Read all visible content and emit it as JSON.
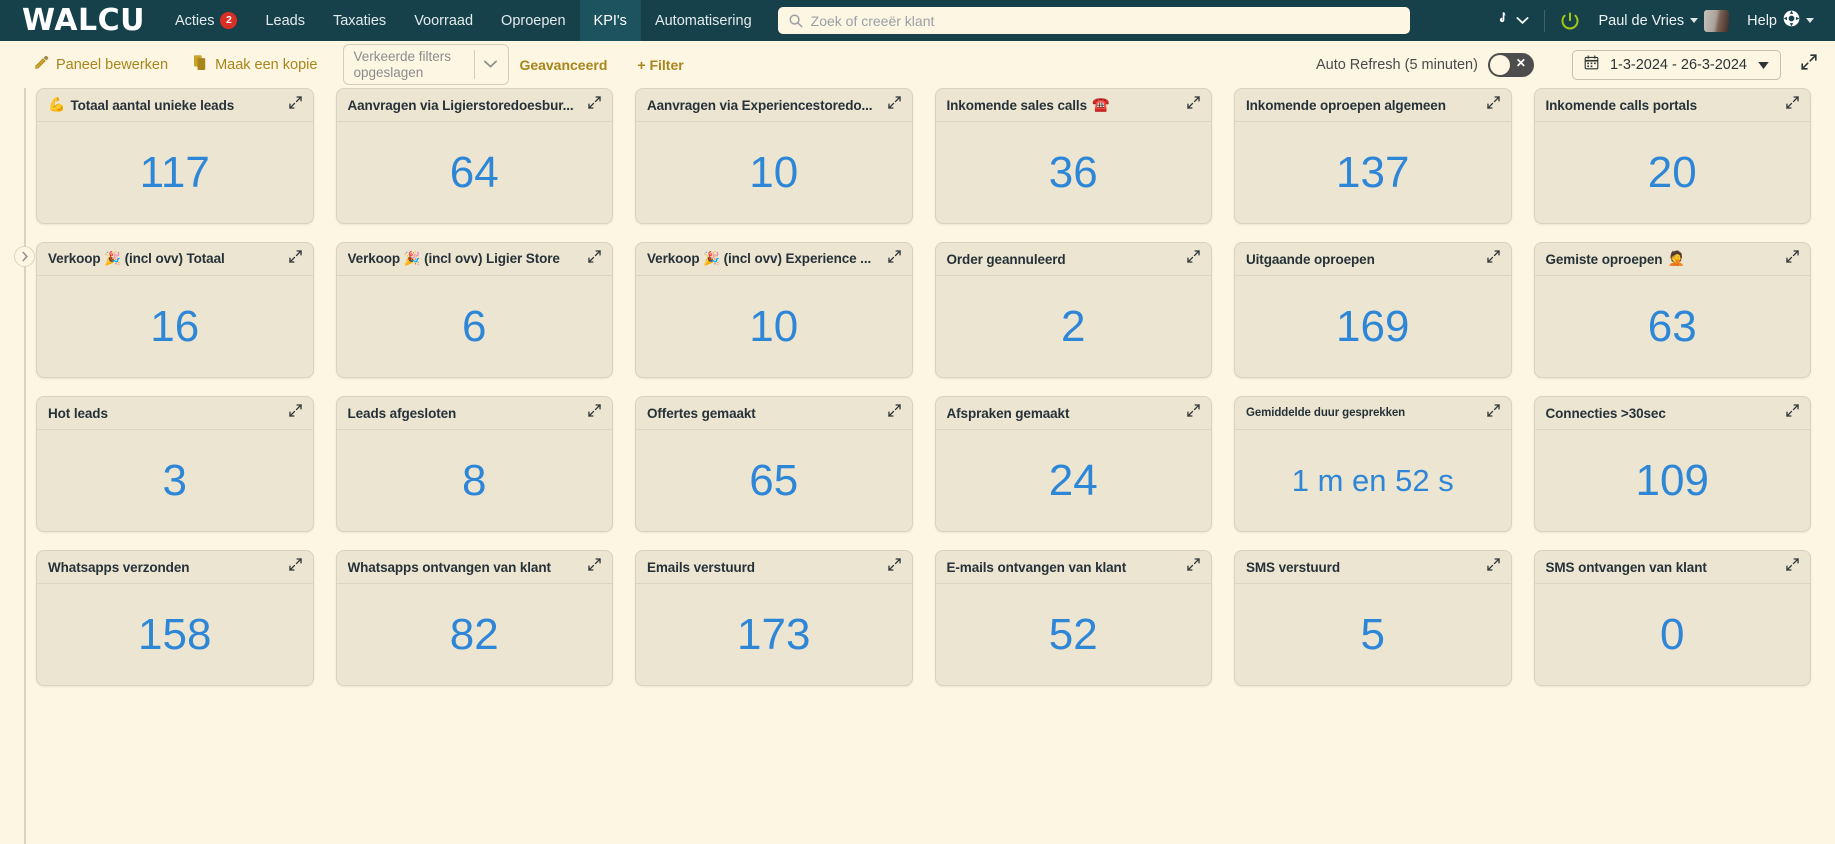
{
  "header": {
    "logo": "WALCU",
    "nav": [
      {
        "label": "Acties",
        "badge": "2",
        "active": false
      },
      {
        "label": "Leads",
        "badge": "",
        "active": false
      },
      {
        "label": "Taxaties",
        "badge": "",
        "active": false
      },
      {
        "label": "Voorraad",
        "badge": "",
        "active": false
      },
      {
        "label": "Oproepen",
        "badge": "",
        "active": false
      },
      {
        "label": "KPI's",
        "badge": "",
        "active": true
      },
      {
        "label": "Automatisering",
        "badge": "",
        "active": false
      }
    ],
    "search": {
      "placeholder": "Zoek of creeër klant",
      "value": ""
    },
    "phone_icon": "phone-icon",
    "power_icon": "power-icon",
    "user_name": "Paul de Vries",
    "help_label": "Help"
  },
  "toolbar": {
    "edit_panel_label": "Paneel bewerken",
    "copy_label": "Maak een kopie",
    "filter_select_value": "Verkeerde filters opgeslagen",
    "advanced_label": "Geavanceerd",
    "add_filter_label": "+ Filter",
    "auto_refresh_label": "Auto Refresh (5 minuten)",
    "auto_refresh_state": "off",
    "date_range": "1-3-2024 - 26-3-2024",
    "calendar_icon": "calendar-icon",
    "expand_icon": "expand-icon"
  },
  "accent_colors": {
    "nav_bg": "#16414b",
    "nav_active_bg": "#1d535f",
    "page_bg": "#fdf6e3",
    "card_bg": "#ece5d2",
    "value_blue": "#2e86d6",
    "link_gold": "#a8851a",
    "badge_red": "#d93025",
    "power_green": "#a5c614"
  },
  "cards": [
    {
      "title": "Totaal aantal unieke leads",
      "emoji": "💪",
      "emoji_pos": "before",
      "value": "117",
      "small_title": false
    },
    {
      "title": "Aanvragen via Ligierstoredoesbur...",
      "emoji": "",
      "emoji_pos": "",
      "value": "64",
      "small_title": false
    },
    {
      "title": "Aanvragen via Experiencestoredo...",
      "emoji": "",
      "emoji_pos": "",
      "value": "10",
      "small_title": false
    },
    {
      "title": "Inkomende sales calls",
      "emoji": "☎️",
      "emoji_pos": "after",
      "value": "36",
      "small_title": false
    },
    {
      "title": "Inkomende oproepen algemeen",
      "emoji": "",
      "emoji_pos": "",
      "value": "137",
      "small_title": false
    },
    {
      "title": "Inkomende calls portals",
      "emoji": "",
      "emoji_pos": "",
      "value": "20",
      "small_title": false
    },
    {
      "title": "Verkoop 🎉 (incl ovv) Totaal",
      "emoji": "",
      "emoji_pos": "",
      "value": "16",
      "small_title": false
    },
    {
      "title": "Verkoop 🎉 (incl ovv) Ligier Store",
      "emoji": "",
      "emoji_pos": "",
      "value": "6",
      "small_title": false
    },
    {
      "title": "Verkoop 🎉 (incl ovv) Experience ...",
      "emoji": "",
      "emoji_pos": "",
      "value": "10",
      "small_title": false
    },
    {
      "title": "Order geannuleerd",
      "emoji": "",
      "emoji_pos": "",
      "value": "2",
      "small_title": false
    },
    {
      "title": "Uitgaande oproepen",
      "emoji": "",
      "emoji_pos": "",
      "value": "169",
      "small_title": false
    },
    {
      "title": "Gemiste oproepen",
      "emoji": "🤦",
      "emoji_pos": "after",
      "value": "63",
      "small_title": false
    },
    {
      "title": "Hot leads",
      "emoji": "",
      "emoji_pos": "",
      "value": "3",
      "small_title": false
    },
    {
      "title": "Leads afgesloten",
      "emoji": "",
      "emoji_pos": "",
      "value": "8",
      "small_title": false
    },
    {
      "title": "Offertes gemaakt",
      "emoji": "",
      "emoji_pos": "",
      "value": "65",
      "small_title": false
    },
    {
      "title": "Afspraken gemaakt",
      "emoji": "",
      "emoji_pos": "",
      "value": "24",
      "small_title": false
    },
    {
      "title": "Gemiddelde duur gesprekken",
      "emoji": "",
      "emoji_pos": "",
      "value": "1 m en 52 s",
      "small_title": true
    },
    {
      "title": "Connecties >30sec",
      "emoji": "",
      "emoji_pos": "",
      "value": "109",
      "small_title": false
    },
    {
      "title": "Whatsapps verzonden",
      "emoji": "",
      "emoji_pos": "",
      "value": "158",
      "small_title": false
    },
    {
      "title": "Whatsapps ontvangen van klant",
      "emoji": "",
      "emoji_pos": "",
      "value": "82",
      "small_title": false
    },
    {
      "title": "Emails verstuurd",
      "emoji": "",
      "emoji_pos": "",
      "value": "173",
      "small_title": false
    },
    {
      "title": "E-mails ontvangen van klant",
      "emoji": "",
      "emoji_pos": "",
      "value": "52",
      "small_title": false
    },
    {
      "title": "SMS verstuurd",
      "emoji": "",
      "emoji_pos": "",
      "value": "5",
      "small_title": false
    },
    {
      "title": "SMS ontvangen van klant",
      "emoji": "",
      "emoji_pos": "",
      "value": "0",
      "small_title": false
    }
  ]
}
